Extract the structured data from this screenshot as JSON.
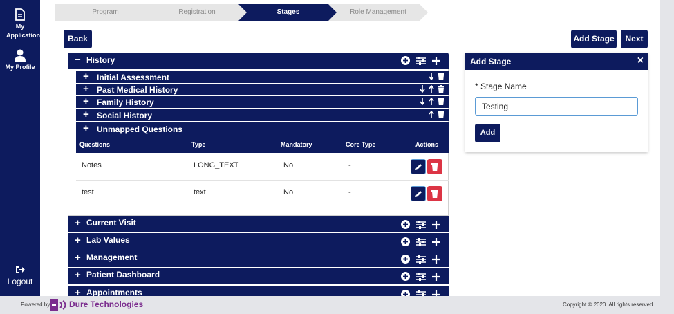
{
  "sidebar": {
    "my_application": "My Application",
    "my_profile": "My Profile",
    "logout": "Logout"
  },
  "stepper": {
    "steps": [
      "Program",
      "Registration",
      "Stages",
      "Role Management"
    ],
    "active": "Stages"
  },
  "toolbar": {
    "back": "Back",
    "add_stage": "Add Stage",
    "next": "Next"
  },
  "history": {
    "label": "History",
    "sign": "−",
    "subsections": [
      {
        "label": "Initial Assessment",
        "sign": "+"
      },
      {
        "label": "Past Medical History",
        "sign": "+"
      },
      {
        "label": "Family History",
        "sign": "+"
      },
      {
        "label": "Social History",
        "sign": "+"
      }
    ],
    "unmapped": {
      "label": "Unmapped Questions",
      "sign": "+",
      "columns": [
        "Questions",
        "Type",
        "Mandatory",
        "Core Type",
        "Actions"
      ],
      "rows": [
        {
          "question": "Notes",
          "type": "LONG_TEXT",
          "mandatory": "No",
          "core_type": "-"
        },
        {
          "question": "test",
          "type": "text",
          "mandatory": "No",
          "core_type": "-"
        }
      ]
    }
  },
  "stages": [
    {
      "label": "Current Visit",
      "sign": "+"
    },
    {
      "label": "Lab Values",
      "sign": "+"
    },
    {
      "label": "Management",
      "sign": "+"
    },
    {
      "label": "Patient Dashboard",
      "sign": "+"
    },
    {
      "label": "Appointments",
      "sign": "+"
    }
  ],
  "add_stage_panel": {
    "title": "Add Stage",
    "close": "×",
    "field_label": "* Stage Name",
    "field_value": "Testing",
    "add_button": "Add"
  },
  "footer": {
    "powered_by": "Powered by",
    "brand": "Dure Technologies",
    "copyright": "Copyright © 2020. All rights reserved"
  },
  "colors": {
    "navy": "#0d1b5e",
    "danger": "#dc3545",
    "brand_purple": "#7b2d8e"
  }
}
